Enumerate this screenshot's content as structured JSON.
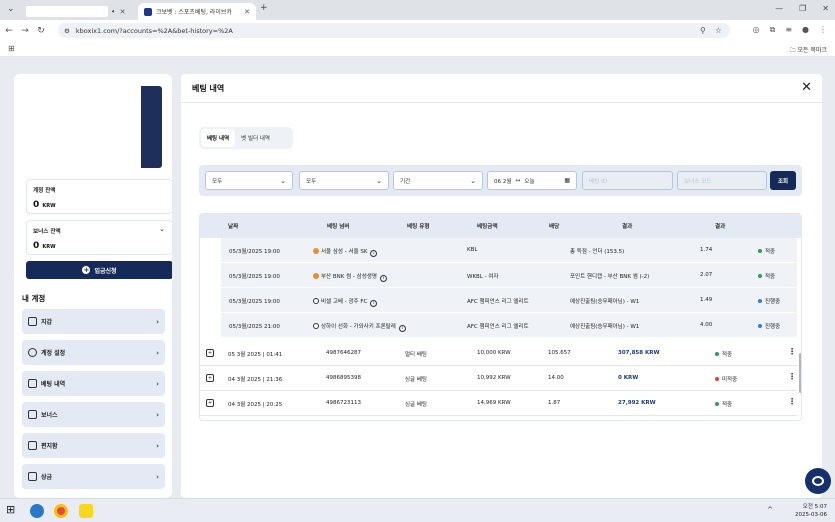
{
  "browser": {
    "tabs": [
      {
        "title": "",
        "close": "✕"
      },
      {
        "title": "크보벳 : 스포츠베팅, 라이브카",
        "close": "✕"
      }
    ],
    "new_tab": "+",
    "url": "kboxix1.com/?accounts=%2A&bet-history=%2A",
    "bookmarks_all": "모든 북마크"
  },
  "sidebar": {
    "balance_label": "계정 잔액",
    "balance_value": "0",
    "balance_currency": "KRW",
    "bonus_label": "보너스 잔액",
    "bonus_value": "0",
    "bonus_currency": "KRW",
    "deposit_label": "입금신청",
    "my_account": "내 계정",
    "menu": [
      {
        "label": "지갑",
        "icon": "wallet-icon"
      },
      {
        "label": "계정 설정",
        "icon": "user-settings-icon"
      },
      {
        "label": "베팅 내역",
        "icon": "bet-history-icon"
      },
      {
        "label": "보너스",
        "icon": "gift-icon"
      },
      {
        "label": "편지함",
        "icon": "inbox-icon"
      },
      {
        "label": "상금",
        "icon": "trophy-icon"
      }
    ]
  },
  "main": {
    "title": "베팅 내역",
    "subtabs": [
      "베팅 내역",
      "벳 빌더 내역"
    ],
    "filters": {
      "select1": "모두",
      "select2": "모두",
      "period": "기간",
      "date_from": "06 2월",
      "date_to": "오늘",
      "bet_id_placeholder": "베팅 ID",
      "bonus_placeholder": "보너스 코드",
      "search": "조회"
    },
    "table": {
      "headers": [
        "날짜",
        "베팅 넘버",
        "베팅 유형",
        "베팅금액",
        "배당",
        "결과",
        "결과"
      ],
      "sub_rows": [
        {
          "date": "05/3월/2025 19:00",
          "match": "서울 삼성 - 서울 SK",
          "sport": "basketball",
          "league": "KBL",
          "market": "총 득점 - 언더 (153.5)",
          "odds": "1.74",
          "status": "적중",
          "status_color": "#2e9e4f"
        },
        {
          "date": "05/3월/2025 19:00",
          "match": "부산 BNK 썸 - 삼성생명",
          "sport": "basketball",
          "league": "WKBL - 여자",
          "market": "포인트 핸디캡 - 부산 BNK 썸 (-2)",
          "odds": "2.07",
          "status": "적중",
          "status_color": "#2e9e4f"
        },
        {
          "date": "05/3월/2025 19:00",
          "match": "비셀 고베 - 광주 FC",
          "sport": "soccer",
          "league": "AFC 챔피언스 리그 엘리트",
          "market": "예상진출팀(승무패아님) - W1",
          "odds": "1.49",
          "status": "진행중",
          "status_color": "#2f7de1"
        },
        {
          "date": "05/3월/2025 21:00",
          "match": "상하이 선화 - 가와사키 프론탈레",
          "sport": "soccer",
          "league": "AFC 챔피언스 리그 엘리트",
          "market": "예상진출팀(승무패아님) - W1",
          "odds": "4.00",
          "status": "진행중",
          "status_color": "#2f7de1"
        }
      ],
      "rows": [
        {
          "date": "05 3월 2025 | 01:41",
          "number": "4987646287",
          "type": "멀티 베팅",
          "amount": "10,000 KRW",
          "odds": "105.657",
          "result": "307,858 KRW",
          "status": "적중",
          "status_color": "#2e9e4f"
        },
        {
          "date": "04 3월 2025 | 21:36",
          "number": "4986895398",
          "type": "싱글 베팅",
          "amount": "10,992 KRW",
          "odds": "14.00",
          "result": "0 KRW",
          "status": "미적중",
          "status_color": "#e0413a"
        },
        {
          "date": "04 3월 2025 | 20:25",
          "number": "4986723113",
          "type": "싱글 베팅",
          "amount": "14,969 KRW",
          "odds": "1.87",
          "result": "27,992 KRW",
          "status": "적중",
          "status_color": "#2e9e4f"
        }
      ]
    }
  },
  "taskbar": {
    "time": "오전 5:07",
    "date": "2025-03-06"
  }
}
